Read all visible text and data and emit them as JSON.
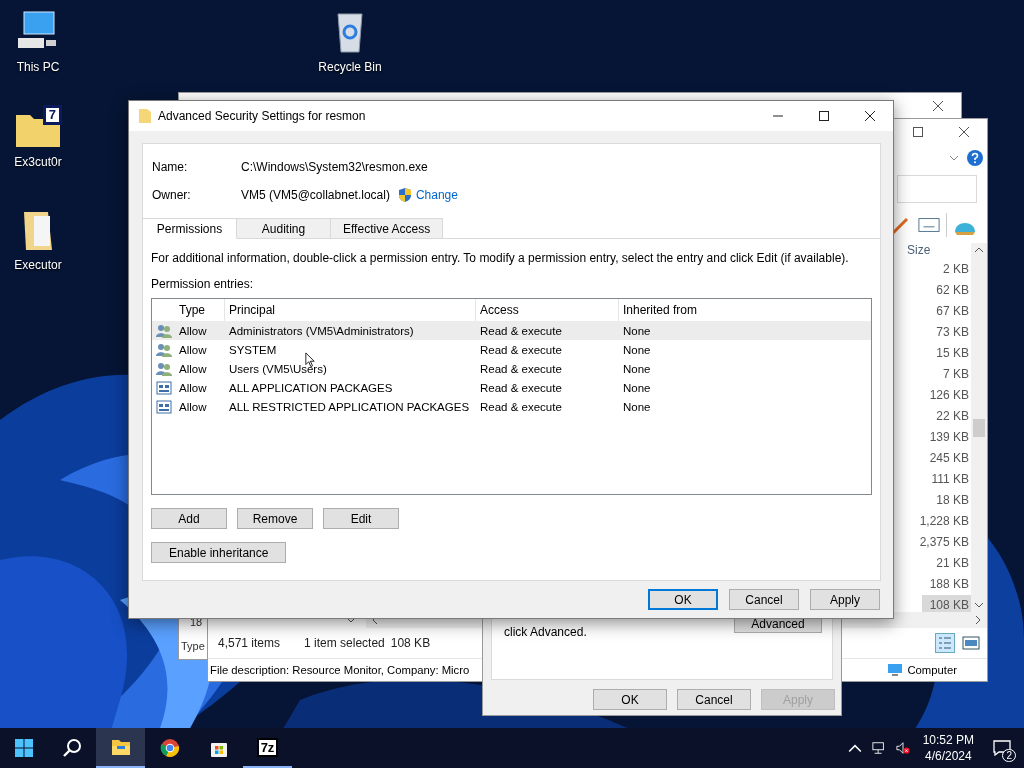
{
  "desktop_icons": [
    {
      "label": "This PC",
      "kind": "pc"
    },
    {
      "label": "Recycle Bin",
      "kind": "bin"
    },
    {
      "label": "Ex3cut0r",
      "kind": "archive",
      "badge": "7"
    },
    {
      "label": "Executor",
      "kind": "folder"
    }
  ],
  "back_window": {
    "row_cut": "18",
    "column_cut": "Type"
  },
  "explorer": {
    "size_header": "Size",
    "sizes": [
      {
        "text": "2 KB",
        "selected": false
      },
      {
        "text": "62 KB",
        "selected": false
      },
      {
        "text": "67 KB",
        "selected": false
      },
      {
        "text": "73 KB",
        "selected": false
      },
      {
        "text": "15 KB",
        "selected": false
      },
      {
        "text": "7 KB",
        "selected": false
      },
      {
        "text": "126 KB",
        "selected": false
      },
      {
        "text": "22 KB",
        "selected": false
      },
      {
        "text": "139 KB",
        "selected": false
      },
      {
        "text": "245 KB",
        "selected": false
      },
      {
        "text": "111 KB",
        "selected": false
      },
      {
        "text": "18 KB",
        "selected": false
      },
      {
        "text": "1,228 KB",
        "selected": false
      },
      {
        "text": "2,375 KB",
        "selected": false
      },
      {
        "text": "21 KB",
        "selected": false
      },
      {
        "text": "188 KB",
        "selected": false
      },
      {
        "text": "108 KB",
        "selected": true
      }
    ],
    "item_count": "4,571 items",
    "selection": "1 item selected",
    "selection_size": "108 KB",
    "details": "File description: Resource Monitor, Company: Micro",
    "zone": "Computer"
  },
  "properties_dialog": {
    "text": "click Advanced.",
    "advanced_button": "Advanced",
    "buttons": [
      {
        "label": "OK",
        "disabled": false
      },
      {
        "label": "Cancel",
        "disabled": false
      },
      {
        "label": "Apply",
        "disabled": true
      }
    ]
  },
  "dialog": {
    "title": "Advanced Security Settings for resmon",
    "name_label": "Name:",
    "name_value": "C:\\Windows\\System32\\resmon.exe",
    "owner_label": "Owner:",
    "owner_value": "VM5 (VM5@collabnet.local)",
    "change_link": "Change",
    "tabs": [
      {
        "label": "Permissions",
        "selected": true
      },
      {
        "label": "Auditing",
        "selected": false
      },
      {
        "label": "Effective Access",
        "selected": false
      }
    ],
    "info": "For additional information, double-click a permission entry. To modify a permission entry, select the entry and click Edit (if available).",
    "entries_label": "Permission entries:",
    "columns": [
      "Type",
      "Principal",
      "Access",
      "Inherited from"
    ],
    "rows": [
      {
        "kind": "user",
        "type": "Allow",
        "principal": "Administrators (VM5\\Administrators)",
        "access": "Read & execute",
        "inherited": "None",
        "selected": true
      },
      {
        "kind": "user",
        "type": "Allow",
        "principal": "SYSTEM",
        "access": "Read & execute",
        "inherited": "None",
        "selected": false
      },
      {
        "kind": "user",
        "type": "Allow",
        "principal": "Users (VM5\\Users)",
        "access": "Read & execute",
        "inherited": "None",
        "selected": false
      },
      {
        "kind": "package",
        "type": "Allow",
        "principal": "ALL APPLICATION PACKAGES",
        "access": "Read & execute",
        "inherited": "None",
        "selected": false
      },
      {
        "kind": "package",
        "type": "Allow",
        "principal": "ALL RESTRICTED APPLICATION PACKAGES",
        "access": "Read & execute",
        "inherited": "None",
        "selected": false
      }
    ],
    "entry_buttons": [
      "Add",
      "Remove",
      "Edit"
    ],
    "inheritance_button": "Enable inheritance",
    "buttons": [
      {
        "label": "OK",
        "default": true
      },
      {
        "label": "Cancel",
        "default": false
      },
      {
        "label": "Apply",
        "default": false
      }
    ]
  },
  "taskbar": {
    "apps": [
      {
        "kind": "explorer",
        "active": true,
        "running": true
      },
      {
        "kind": "chrome",
        "active": false,
        "running": false
      },
      {
        "kind": "store",
        "active": false,
        "running": false
      },
      {
        "kind": "archiver",
        "label": "7z",
        "active": false,
        "running": true
      }
    ],
    "time": "10:52 PM",
    "date": "4/6/2024",
    "notifications": "2"
  }
}
